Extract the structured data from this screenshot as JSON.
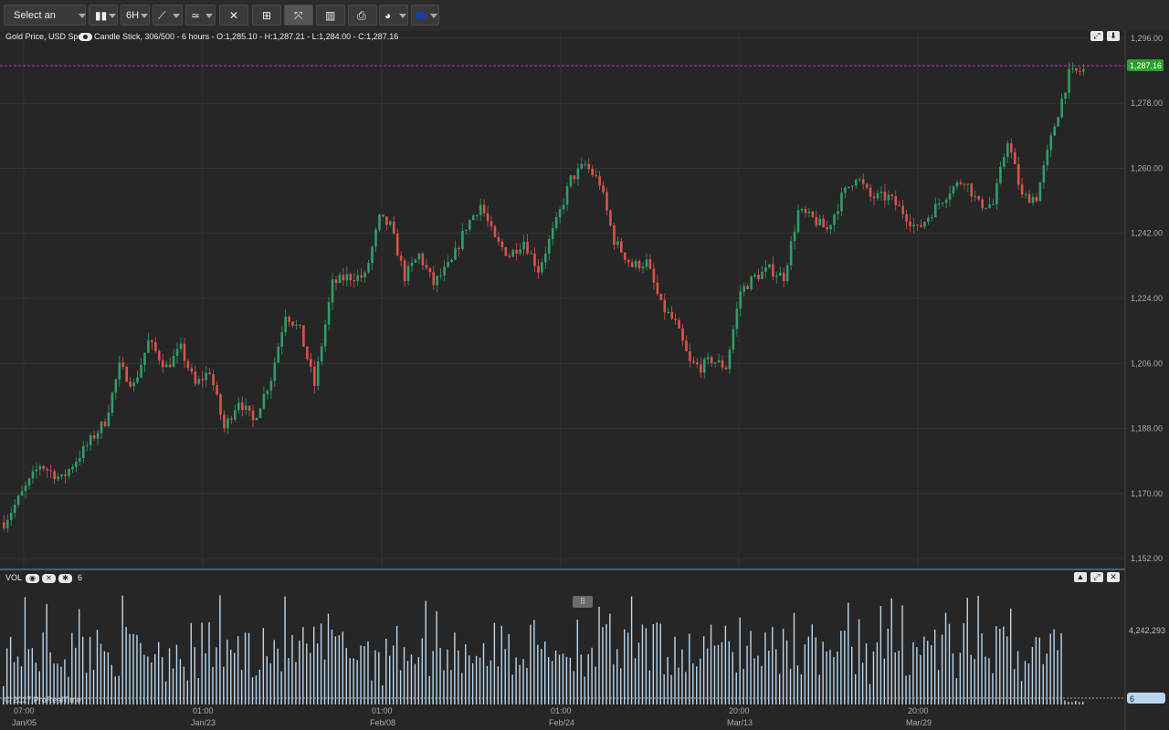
{
  "toolbar": {
    "select_label": "Select an option",
    "interval_label": "6H",
    "icons": [
      "candlestick-icon",
      "interval-selector",
      "line-draw-icon",
      "indicator-icon",
      "crosshair-icon",
      "layout-icon",
      "fullscreen-icon",
      "bar-chart-icon",
      "print-icon",
      "theme-icon",
      "flag-uk-icon"
    ]
  },
  "header": {
    "instrument": "Gold Price, USD Spot",
    "info": "Candle Stick, 306/500 - 6 hours - O:1,285.10 - H:1,287.21 - L:1,284.00 - C:1,287.16"
  },
  "volume_panel": {
    "label": "VOL",
    "value": "6",
    "axis_label": "4,242,293",
    "last_value_tag": "6"
  },
  "watermark": "© 2017 ProRealTime",
  "colors": {
    "background": "#262626",
    "up": "#2e9e6a",
    "down": "#d9544a",
    "volume": "#b9d6ee",
    "last_price_tag": "#2e9e2e",
    "last_price_line": "#b03cb8"
  },
  "chart_data": {
    "type": "candlestick",
    "price_axis": {
      "ticks": [
        "1,296.00",
        "1,278.00",
        "1,260.00",
        "1,242.00",
        "1,224.00",
        "1,206.00",
        "1,188.00",
        "1,170.00",
        "1,152.00"
      ],
      "ylim": [
        1149,
        1298
      ]
    },
    "last_price": "1,287.16",
    "x_axis": {
      "times": [
        "07:00",
        "01:00",
        "01:00",
        "01:00",
        "20:00",
        "20:00"
      ],
      "dates": [
        "Jan/05",
        "Jan/23",
        "Feb/08",
        "Feb/24",
        "Mar/13",
        "Mar/29"
      ]
    },
    "price_path": [
      [
        0,
        1162
      ],
      [
        10,
        1178
      ],
      [
        16,
        1174
      ],
      [
        22,
        1182
      ],
      [
        28,
        1190
      ],
      [
        32,
        1205
      ],
      [
        36,
        1200
      ],
      [
        40,
        1212
      ],
      [
        45,
        1205
      ],
      [
        49,
        1210
      ],
      [
        53,
        1200
      ],
      [
        57,
        1204
      ],
      [
        61,
        1188
      ],
      [
        65,
        1196
      ],
      [
        69,
        1190
      ],
      [
        74,
        1202
      ],
      [
        78,
        1220
      ],
      [
        82,
        1215
      ],
      [
        86,
        1200
      ],
      [
        91,
        1228
      ],
      [
        95,
        1230
      ],
      [
        100,
        1230
      ],
      [
        104,
        1246
      ],
      [
        107,
        1244
      ],
      [
        111,
        1230
      ],
      [
        115,
        1236
      ],
      [
        119,
        1228
      ],
      [
        124,
        1234
      ],
      [
        128,
        1244
      ],
      [
        132,
        1250
      ],
      [
        136,
        1240
      ],
      [
        140,
        1236
      ],
      [
        144,
        1240
      ],
      [
        148,
        1232
      ],
      [
        153,
        1245
      ],
      [
        157,
        1257
      ],
      [
        161,
        1261
      ],
      [
        165,
        1256
      ],
      [
        169,
        1240
      ],
      [
        174,
        1233
      ],
      [
        178,
        1234
      ],
      [
        182,
        1222
      ],
      [
        186,
        1217
      ],
      [
        190,
        1206
      ],
      [
        193,
        1205
      ],
      [
        196,
        1207
      ],
      [
        200,
        1205
      ],
      [
        204,
        1226
      ],
      [
        208,
        1230
      ],
      [
        212,
        1232
      ],
      [
        216,
        1230
      ],
      [
        220,
        1248
      ],
      [
        224,
        1246
      ],
      [
        228,
        1243
      ],
      [
        232,
        1252
      ],
      [
        236,
        1258
      ],
      [
        240,
        1252
      ],
      [
        245,
        1252
      ],
      [
        249,
        1248
      ],
      [
        253,
        1243
      ],
      [
        257,
        1248
      ],
      [
        262,
        1254
      ],
      [
        266,
        1257
      ],
      [
        270,
        1250
      ],
      [
        274,
        1250
      ],
      [
        278,
        1268
      ],
      [
        282,
        1252
      ],
      [
        286,
        1252
      ],
      [
        291,
        1272
      ],
      [
        295,
        1286
      ],
      [
        299,
        1287.16
      ]
    ],
    "volume": {
      "ylim": [
        0,
        6800000
      ],
      "bars": 300
    }
  }
}
